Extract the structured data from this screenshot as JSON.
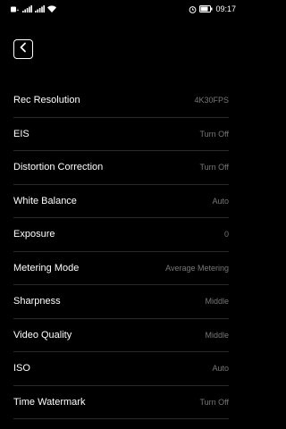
{
  "status_bar": {
    "time": "09:17",
    "battery_level": 0.8,
    "left_icons": [
      "sim-icon",
      "signal-icon",
      "signal-icon",
      "wifi-icon"
    ],
    "right_icons": [
      "alarm-icon",
      "battery-icon"
    ]
  },
  "header": {
    "back_icon": "chevron-left-icon"
  },
  "settings": [
    {
      "label": "Rec Resolution",
      "value": "4K30FPS"
    },
    {
      "label": "EIS",
      "value": "Turn Off"
    },
    {
      "label": "Distortion Correction",
      "value": "Turn Off"
    },
    {
      "label": "White Balance",
      "value": "Auto"
    },
    {
      "label": "Exposure",
      "value": "0"
    },
    {
      "label": "Metering Mode",
      "value": "Average Metering"
    },
    {
      "label": "Sharpness",
      "value": "Middle"
    },
    {
      "label": "Video Quality",
      "value": "Middle"
    },
    {
      "label": "ISO",
      "value": "Auto"
    },
    {
      "label": "Time Watermark",
      "value": "Turn Off"
    }
  ]
}
